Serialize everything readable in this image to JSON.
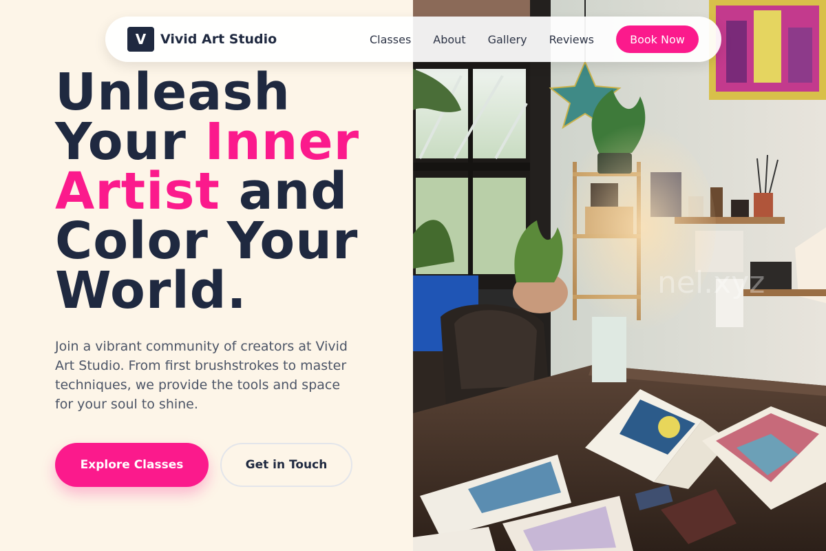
{
  "navbar": {
    "logo_letter": "V",
    "brand_name": "Vivid Art Studio",
    "links": [
      "Classes",
      "About",
      "Gallery",
      "Reviews"
    ],
    "book_label": "Book Now"
  },
  "hero": {
    "line1": "Unleash",
    "line2_a": "Your ",
    "line2_b": "Inner",
    "line3_a": "Artist",
    "line3_b": " and",
    "line4": "Color Your",
    "line5": "World.",
    "subtitle": "Join a vibrant community of creators at Vivid Art Studio. From first brushstrokes to master techniques, we provide the tools and space for your soul to shine.",
    "primary_cta": "Explore Classes",
    "secondary_cta": "Get in Touch"
  },
  "photo": {
    "watermark": "nel.xyz"
  },
  "colors": {
    "accent": "#fb1a8c",
    "navy": "#1f2940",
    "background": "#fdf5e8"
  }
}
